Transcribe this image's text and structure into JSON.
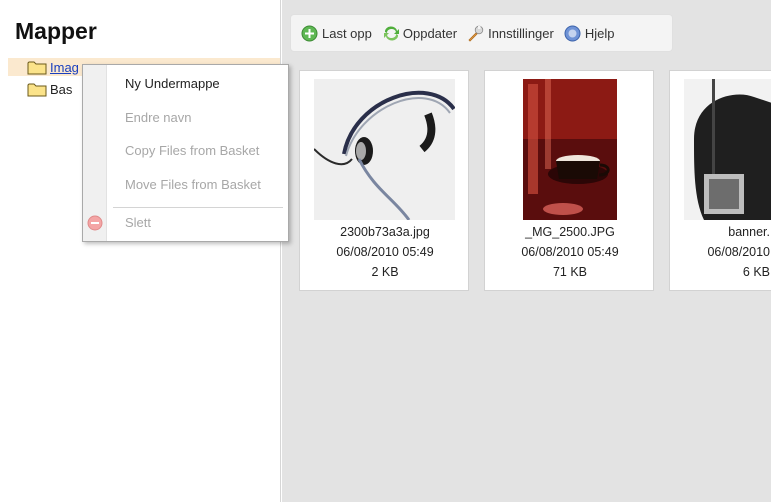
{
  "sidebar": {
    "title": "Mapper",
    "items": [
      {
        "label": "Images",
        "visible_label": "Imag",
        "selected": true
      },
      {
        "label": "Basket",
        "visible_label": "Bas",
        "selected": false
      }
    ]
  },
  "toolbar": {
    "buttons": [
      {
        "label": "Last opp",
        "icon": "upload-icon"
      },
      {
        "label": "Oppdater",
        "icon": "refresh-icon"
      },
      {
        "label": "Innstillinger",
        "icon": "wrench-icon"
      },
      {
        "label": "Hjelp",
        "icon": "help-icon"
      }
    ]
  },
  "files": [
    {
      "name": "2300b73a3a.jpg",
      "date": "06/08/2010 05:49",
      "size": "2 KB",
      "thumbnail": "headset-icon"
    },
    {
      "name": "_MG_2500.JPG",
      "date": "06/08/2010 05:49",
      "size": "71 KB",
      "thumbnail": "coffee-photo"
    },
    {
      "name": "banner.",
      "date": "06/08/2010",
      "size": "6 KB",
      "thumbnail": "microphone-photo"
    }
  ],
  "context_menu": {
    "items": [
      {
        "label": "Ny Undermappe",
        "enabled": true
      },
      {
        "label": "Endre navn",
        "enabled": false
      },
      {
        "label": "Copy Files from Basket",
        "enabled": false
      },
      {
        "label": "Move Files from Basket",
        "enabled": false
      },
      {
        "label": "Slett",
        "enabled": false,
        "icon": "delete-icon"
      }
    ]
  },
  "colors": {
    "selected_item_bg": "#fbe9cf",
    "link": "#1a3fbf",
    "content_bg": "#e3e3e3",
    "disabled_text": "#a7a7a7"
  }
}
